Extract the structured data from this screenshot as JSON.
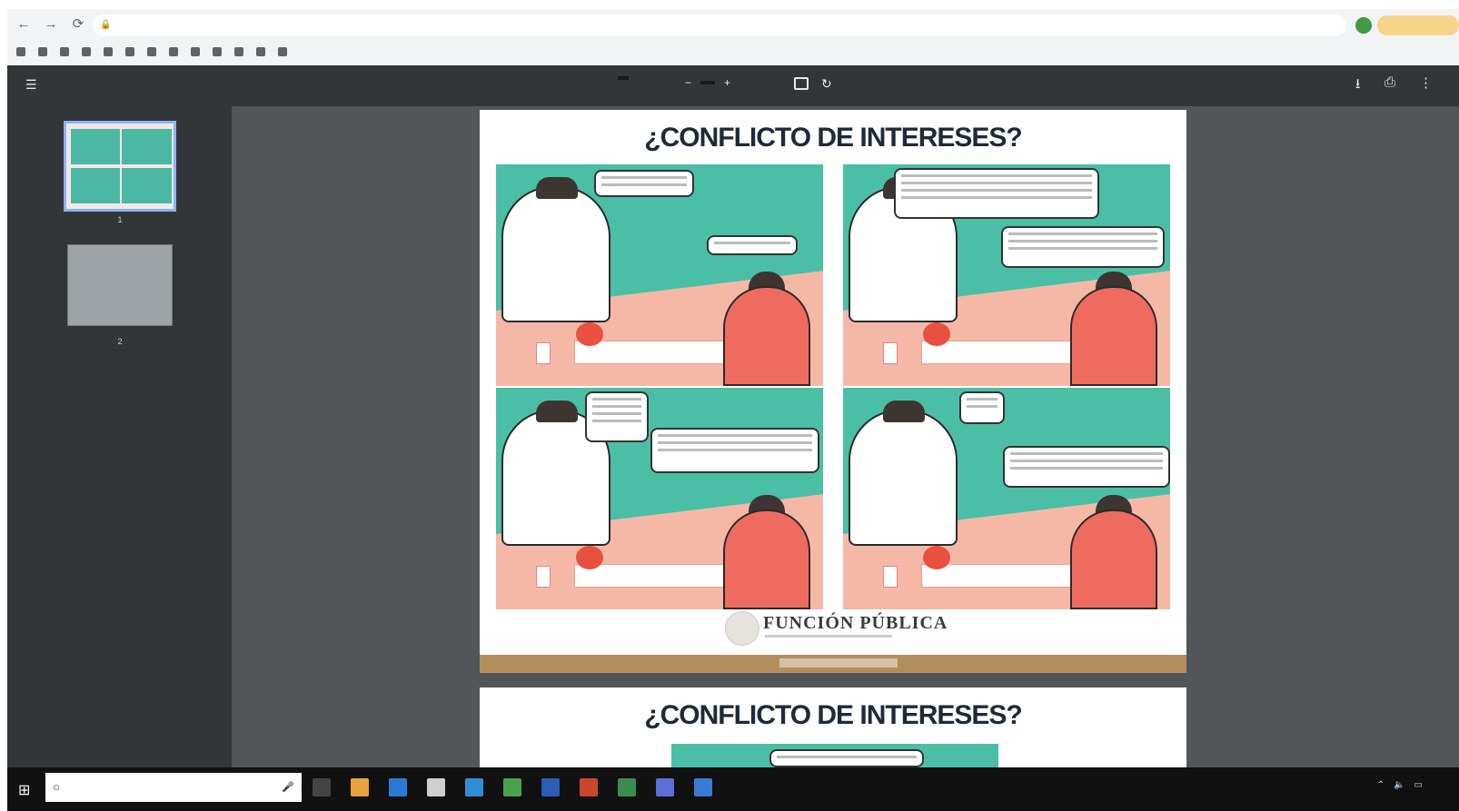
{
  "browser": {
    "back_icon": "arrow-left-icon",
    "forward_icon": "arrow-right-icon",
    "reload_icon": "reload-icon",
    "url": "",
    "update_label": "",
    "bookmarks": []
  },
  "pdf_viewer": {
    "document_title": "",
    "page_current": "",
    "page_total": "",
    "zoom_level": "",
    "zoom_out": "−",
    "zoom_in": "+",
    "thumbnails": [
      "1",
      "2"
    ],
    "page_heading": "¿CONFLICTO DE INTERESES?",
    "logo_text": "FUNCIÓN PÚBLICA"
  },
  "comic": {
    "colors": {
      "teal": "#4bbfa6",
      "pink": "#f5b8a7",
      "shirt": "#ef6b5f",
      "gold": "#b38e5d"
    },
    "panel_count": 4
  },
  "taskbar": {
    "search_placeholder": "",
    "time": "",
    "date": ""
  }
}
